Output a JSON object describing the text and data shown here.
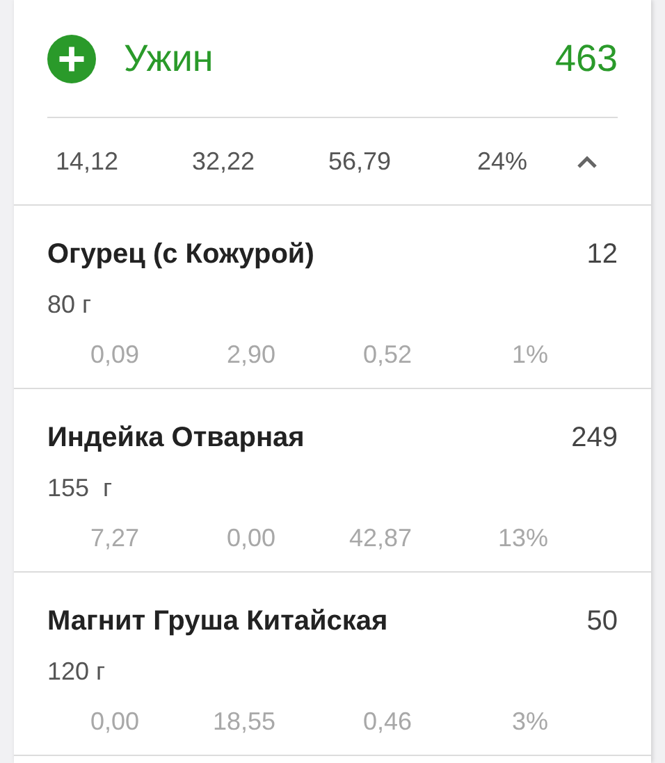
{
  "meal": {
    "title": "Ужин",
    "calories": "463",
    "summary": [
      "14,12",
      "32,22",
      "56,79",
      "24%"
    ],
    "expanded": true
  },
  "items": [
    {
      "name": "Огурец (с Кожурой)",
      "calories": "12",
      "weight": "80 г",
      "nutrients": [
        "0,09",
        "2,90",
        "0,52",
        "1%"
      ]
    },
    {
      "name": "Индейка Отварная",
      "calories": "249",
      "weight": "155  г",
      "nutrients": [
        "7,27",
        "0,00",
        "42,87",
        "13%"
      ]
    },
    {
      "name": "Магнит Груша Китайская",
      "calories": "50",
      "weight": "120 г",
      "nutrients": [
        "0,00",
        "18,55",
        "0,46",
        "3%"
      ]
    }
  ]
}
